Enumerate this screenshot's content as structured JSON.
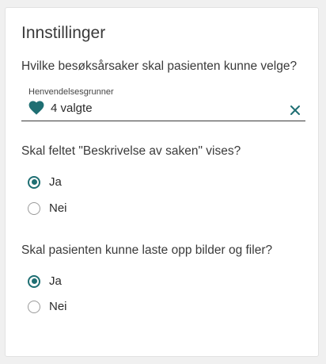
{
  "colors": {
    "accent": "#1f6f73",
    "text": "#2b2b2b",
    "border": "#3a3a3a"
  },
  "settings": {
    "title": "Innstillinger",
    "reasons": {
      "question": "Hvilke besøksårsaker skal pasienten kunne velge?",
      "field_label": "Henvendelsesgrunner",
      "field_value": "4 valgte",
      "icon": "heart-icon",
      "clear_icon": "close-icon"
    },
    "description_visible": {
      "question": "Skal feltet \"Beskrivelse av saken\" vises?",
      "options": [
        {
          "label": "Ja",
          "selected": true
        },
        {
          "label": "Nei",
          "selected": false
        }
      ]
    },
    "upload_files": {
      "question": "Skal pasienten kunne laste opp bilder og filer?",
      "options": [
        {
          "label": "Ja",
          "selected": true
        },
        {
          "label": "Nei",
          "selected": false
        }
      ]
    }
  }
}
